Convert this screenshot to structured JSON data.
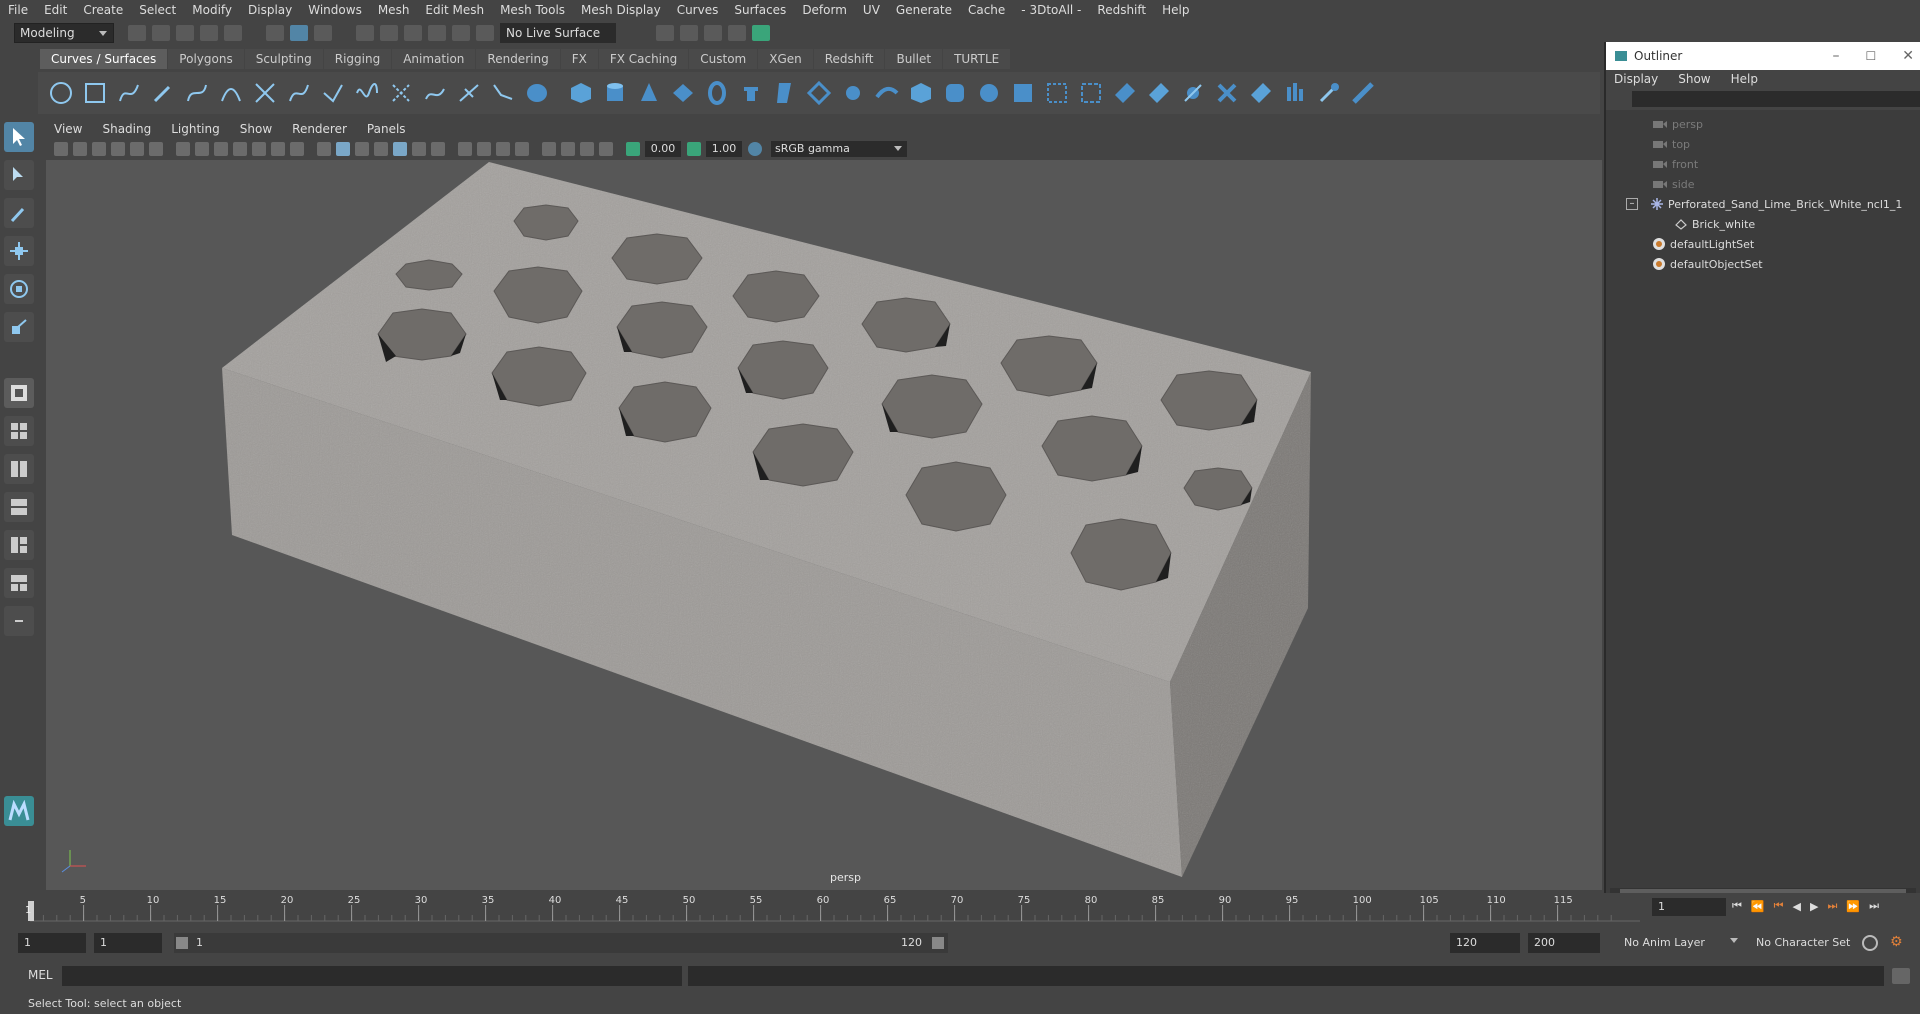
{
  "menubar": {
    "items": [
      "File",
      "Edit",
      "Create",
      "Select",
      "Modify",
      "Display",
      "Windows",
      "Mesh",
      "Edit Mesh",
      "Mesh Tools",
      "Mesh Display",
      "Curves",
      "Surfaces",
      "Deform",
      "UV",
      "Generate",
      "Cache",
      "- 3DtoAll -",
      "Redshift",
      "Help"
    ]
  },
  "statusline": {
    "mode": "Modeling",
    "live_surface": "No Live Surface"
  },
  "shelf": {
    "tabs": [
      "Curves / Surfaces",
      "Polygons",
      "Sculpting",
      "Rigging",
      "Animation",
      "Rendering",
      "FX",
      "FX Caching",
      "Custom",
      "XGen",
      "Redshift",
      "Bullet",
      "TURTLE"
    ],
    "active_tab": "Curves / Surfaces"
  },
  "viewport": {
    "menu": [
      "View",
      "Shading",
      "Lighting",
      "Show",
      "Renderer",
      "Panels"
    ],
    "exposure": "0.00",
    "gamma": "1.00",
    "color_space": "sRGB gamma",
    "camera_label": "persp"
  },
  "outliner": {
    "title": "Outliner",
    "menu": [
      "Display",
      "Show",
      "Help"
    ],
    "items": [
      {
        "label": "persp",
        "icon": "camera-icon",
        "dim": true
      },
      {
        "label": "top",
        "icon": "camera-icon",
        "dim": true
      },
      {
        "label": "front",
        "icon": "camera-icon",
        "dim": true
      },
      {
        "label": "side",
        "icon": "camera-icon",
        "dim": true
      },
      {
        "label": "Perforated_Sand_Lime_Brick_White_ncl1_1",
        "icon": "group-icon",
        "dim": false
      },
      {
        "label": "Brick_white",
        "icon": "mesh-icon",
        "dim": false
      },
      {
        "label": "defaultLightSet",
        "icon": "set-icon",
        "dim": false
      },
      {
        "label": "defaultObjectSet",
        "icon": "set-icon",
        "dim": false
      }
    ]
  },
  "timeline": {
    "ticks": [
      "5",
      "10",
      "15",
      "20",
      "25",
      "30",
      "35",
      "40",
      "45",
      "50",
      "55",
      "60",
      "65",
      "70",
      "75",
      "80",
      "85",
      "90",
      "95",
      "100",
      "105",
      "110",
      "115"
    ],
    "start_label": "1",
    "current_frame": "1"
  },
  "range": {
    "start": "1",
    "playback_start": "1",
    "slider_start": "1",
    "slider_end": "120",
    "playback_end": "120",
    "end": "200",
    "anim_layer": "No Anim Layer",
    "character_set": "No Character Set"
  },
  "command": {
    "label": "MEL"
  },
  "help": {
    "text": "Select Tool: select an object"
  }
}
